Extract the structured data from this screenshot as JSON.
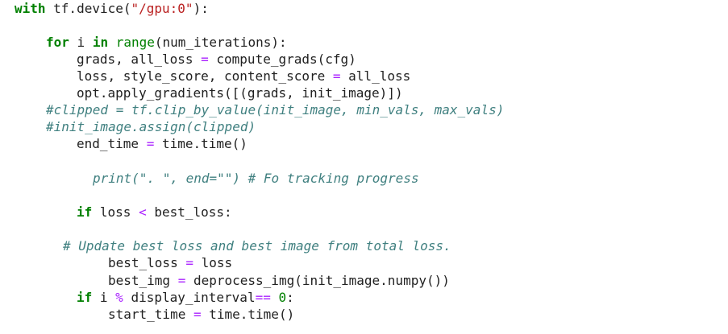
{
  "lines": [
    {
      "parts": [
        {
          "t": "with",
          "c": "kw"
        },
        {
          "t": " tf.device(",
          "c": ""
        },
        {
          "t": "\"/gpu:0\"",
          "c": "str"
        },
        {
          "t": "):",
          "c": ""
        }
      ]
    },
    {
      "parts": [
        {
          "t": "for",
          "c": "kw"
        },
        {
          "t": " i ",
          "c": ""
        },
        {
          "t": "in",
          "c": "kw"
        },
        {
          "t": " ",
          "c": ""
        },
        {
          "t": "range",
          "c": "fn"
        },
        {
          "t": "(num_iterations):",
          "c": ""
        }
      ]
    },
    {
      "parts": [
        {
          "t": "grads, all_loss ",
          "c": ""
        },
        {
          "t": "=",
          "c": "op"
        },
        {
          "t": " compute_grads(cfg)",
          "c": ""
        }
      ]
    },
    {
      "parts": [
        {
          "t": "loss, style_score, content_score ",
          "c": ""
        },
        {
          "t": "=",
          "c": "op"
        },
        {
          "t": " all_loss",
          "c": ""
        }
      ]
    },
    {
      "parts": [
        {
          "t": "opt.apply_gradients([(grads, init_image)])",
          "c": ""
        }
      ]
    },
    {
      "parts": [
        {
          "t": "#clipped = tf.clip_by_value(init_image, min_vals, max_vals)",
          "c": "com"
        }
      ]
    },
    {
      "parts": [
        {
          "t": "#init_image.assign(clipped)",
          "c": "com"
        }
      ]
    },
    {
      "parts": [
        {
          "t": "end_time ",
          "c": ""
        },
        {
          "t": "=",
          "c": "op"
        },
        {
          "t": " time.time()",
          "c": ""
        }
      ]
    },
    {
      "parts": [
        {
          "t": "print(\". \", end=\"\") # Fo tracking progress",
          "c": "com"
        }
      ]
    },
    {
      "parts": [
        {
          "t": "if",
          "c": "kw"
        },
        {
          "t": " loss ",
          "c": ""
        },
        {
          "t": "<",
          "c": "op"
        },
        {
          "t": " best_loss:",
          "c": ""
        }
      ]
    },
    {
      "parts": [
        {
          "t": "# Update best loss and best image from total loss.",
          "c": "com"
        }
      ]
    },
    {
      "parts": [
        {
          "t": "best_loss ",
          "c": ""
        },
        {
          "t": "=",
          "c": "op"
        },
        {
          "t": " loss",
          "c": ""
        }
      ]
    },
    {
      "parts": [
        {
          "t": "best_img ",
          "c": ""
        },
        {
          "t": "=",
          "c": "op"
        },
        {
          "t": " deprocess_img(init_image.numpy())",
          "c": ""
        }
      ]
    },
    {
      "parts": [
        {
          "t": "if",
          "c": "kw"
        },
        {
          "t": " i ",
          "c": ""
        },
        {
          "t": "%",
          "c": "op"
        },
        {
          "t": " display_interval",
          "c": ""
        },
        {
          "t": "==",
          "c": "op"
        },
        {
          "t": " ",
          "c": ""
        },
        {
          "t": "0",
          "c": "num"
        },
        {
          "t": ":",
          "c": ""
        }
      ]
    },
    {
      "parts": [
        {
          "t": "start_time ",
          "c": ""
        },
        {
          "t": "=",
          "c": "op"
        },
        {
          "t": " time.time()",
          "c": ""
        }
      ]
    }
  ]
}
